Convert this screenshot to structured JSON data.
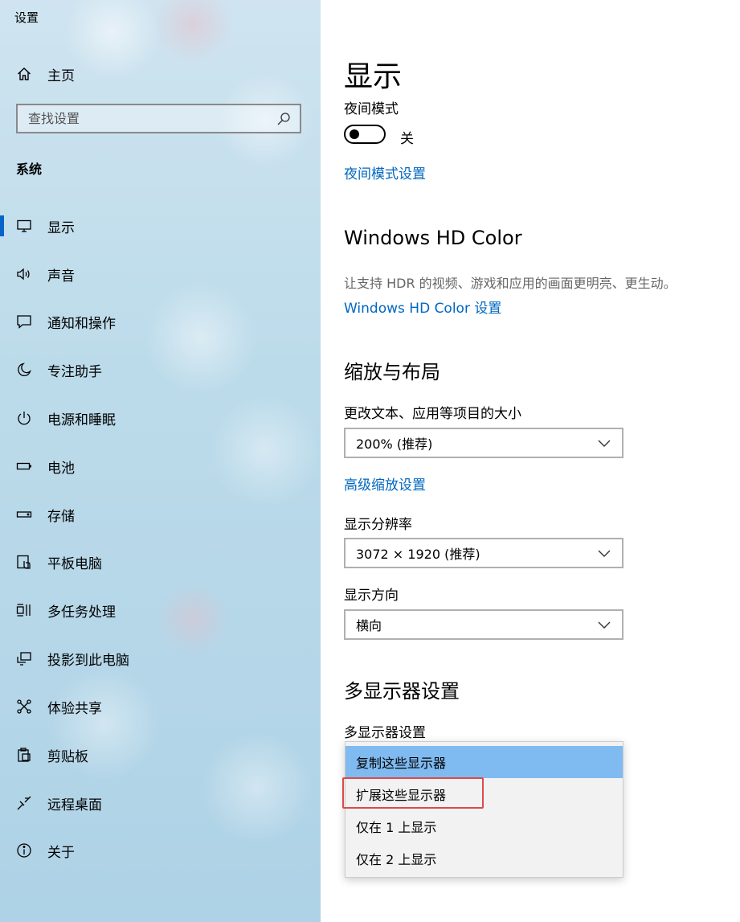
{
  "window": {
    "title": "设置"
  },
  "sidebar": {
    "home_label": "主页",
    "search_placeholder": "查找设置",
    "section_title": "系统",
    "items": [
      {
        "label": "显示",
        "icon": "monitor-icon",
        "active": true
      },
      {
        "label": "声音",
        "icon": "speaker-icon"
      },
      {
        "label": "通知和操作",
        "icon": "notification-icon"
      },
      {
        "label": "专注助手",
        "icon": "moon-icon"
      },
      {
        "label": "电源和睡眠",
        "icon": "power-icon"
      },
      {
        "label": "电池",
        "icon": "battery-icon"
      },
      {
        "label": "存储",
        "icon": "storage-icon"
      },
      {
        "label": "平板电脑",
        "icon": "tablet-icon"
      },
      {
        "label": "多任务处理",
        "icon": "multitask-icon"
      },
      {
        "label": "投影到此电脑",
        "icon": "projection-icon"
      },
      {
        "label": "体验共享",
        "icon": "share-icon"
      },
      {
        "label": "剪贴板",
        "icon": "clipboard-icon"
      },
      {
        "label": "远程桌面",
        "icon": "remote-desktop-icon"
      },
      {
        "label": "关于",
        "icon": "info-icon"
      }
    ]
  },
  "main": {
    "title": "显示",
    "night_mode": {
      "label": "夜间模式",
      "state_text": "关",
      "on": false,
      "settings_link": "夜间模式设置"
    },
    "hdr": {
      "heading": "Windows HD Color",
      "description": "让支持 HDR 的视频、游戏和应用的画面更明亮、更生动。",
      "link": "Windows HD Color 设置"
    },
    "scale": {
      "heading": "缩放与布局",
      "size_label": "更改文本、应用等项目的大小",
      "size_value": "200% (推荐)",
      "advanced_link": "高级缩放设置",
      "resolution_label": "显示分辨率",
      "resolution_value": "3072 × 1920 (推荐)",
      "orientation_label": "显示方向",
      "orientation_value": "横向"
    },
    "multi": {
      "heading": "多显示器设置",
      "label": "多显示器设置",
      "options": [
        "复制这些显示器",
        "扩展这些显示器",
        "仅在 1 上显示",
        "仅在 2 上显示"
      ],
      "selected_index": 0,
      "highlighted_index": 1
    }
  },
  "colors": {
    "accent": "#0067c0",
    "active_bar": "#0a64c8",
    "selected_option": "#7fbaf0",
    "highlight_box": "#e04848"
  }
}
